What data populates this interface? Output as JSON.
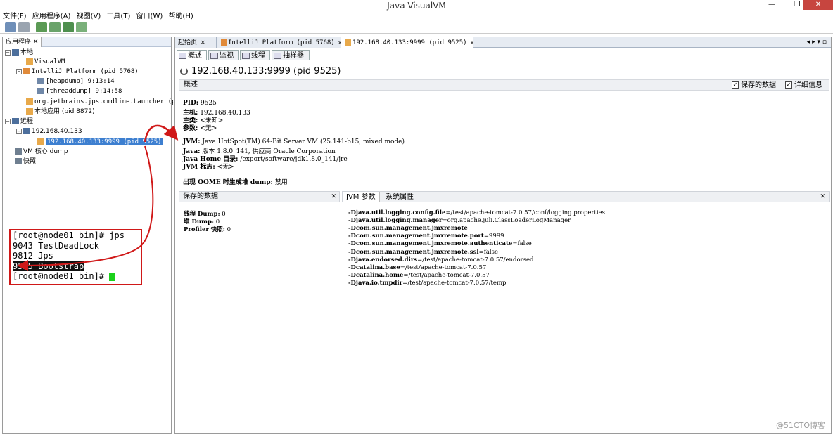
{
  "window": {
    "title": "Java VisualVM",
    "minimize": "—",
    "maximize": "❐",
    "close": "✕"
  },
  "menu": [
    "文件(F)",
    "应用程序(A)",
    "视图(V)",
    "工具(T)",
    "窗口(W)",
    "帮助(H)"
  ],
  "left_panel": {
    "tab_label": "应用程序",
    "tab_close": "✕",
    "minimize": "—",
    "tree": [
      {
        "label": "本地",
        "toggle": "−"
      },
      {
        "label": "VisualVM"
      },
      {
        "label": "IntelliJ Platform (pid 5768)",
        "toggle": "−"
      },
      {
        "label": "[heapdump] 9:13:14"
      },
      {
        "label": "[threaddump] 9:14:58"
      },
      {
        "label": "org.jetbrains.jps.cmdline.Launcher (pid"
      },
      {
        "label": "本地应用 (pid 8872)"
      },
      {
        "label": "远程",
        "toggle": "−"
      },
      {
        "label": "192.168.40.133",
        "toggle": "−"
      },
      {
        "label": "192.168.40.133:9999 (pid 9525)"
      },
      {
        "label": "VM 核心 dump"
      },
      {
        "label": "快照"
      }
    ]
  },
  "terminal": {
    "lines": [
      "[root@node01 bin]# jps",
      "9043 TestDeadLock",
      "9812 Jps"
    ],
    "highlight_pid": "9525",
    "highlight_name": "Bootstrap",
    "prompt": "[root@node01 bin]# "
  },
  "doc_tabs": [
    {
      "label": "起始页",
      "close": "✕"
    },
    {
      "label": "IntelliJ Platform (pid 5768)",
      "close": "✕"
    },
    {
      "label": "192.168.40.133:9999 (pid 9525)",
      "close": "✕"
    }
  ],
  "doc_tabs_nav": "◂ ▸ ▾ ▫",
  "sub_tabs": [
    "概述",
    "监视",
    "线程",
    "抽样器"
  ],
  "host_title": "192.168.40.133:9999 (pid 9525)",
  "overview": {
    "header": "概述",
    "checkbox_saved": "保存的数据",
    "checkbox_detail": "详细信息",
    "check": "✓",
    "pid_label": "PID:",
    "pid": "9525",
    "host_label": "主机:",
    "host": "192.168.40.133",
    "main_class_label": "主类:",
    "main_class": "<未知>",
    "args_label": "参数:",
    "args": "<无>",
    "jvm_label": "JVM:",
    "jvm": "Java HotSpot(TM) 64-Bit Server VM (25.141-b15, mixed mode)",
    "java_label": "Java:",
    "java": "版本 1.8.0_141, 供应商 Oracle Corporation",
    "java_home_label": "Java Home 目录:",
    "java_home": "/export/software/jdk1.8.0_141/jre",
    "jvm_flags_label": "JVM 标志:",
    "jvm_flags": "<无>",
    "oome_label": "出现 OOME 时生成堆 dump:",
    "oome": "禁用"
  },
  "saved_panel": {
    "title": "保存的数据",
    "close": "✕",
    "rows": [
      {
        "label": "线程 Dump:",
        "value": "0"
      },
      {
        "label": "堆 Dump:",
        "value": "0"
      },
      {
        "label": "Profiler 快照:",
        "value": "0"
      }
    ]
  },
  "jvm_panel": {
    "tabs": [
      "JVM 参数",
      "系统属性"
    ],
    "close": "✕",
    "args": [
      {
        "key": "-Djava.util.logging.config.file",
        "val": "=/test/apache-tomcat-7.0.57/conf/logging.properties"
      },
      {
        "key": "-Djava.util.logging.manager",
        "val": "=org.apache.juli.ClassLoaderLogManager"
      },
      {
        "key": "-Dcom.sun.management.jmxremote",
        "val": ""
      },
      {
        "key": "-Dcom.sun.management.jmxremote.port",
        "val": "=9999"
      },
      {
        "key": "-Dcom.sun.management.jmxremote.authenticate",
        "val": "=false"
      },
      {
        "key": "-Dcom.sun.management.jmxremote.ssl",
        "val": "=false"
      },
      {
        "key": "-Djava.endorsed.dirs",
        "val": "=/test/apache-tomcat-7.0.57/endorsed"
      },
      {
        "key": "-Dcatalina.base",
        "val": "=/test/apache-tomcat-7.0.57"
      },
      {
        "key": "-Dcatalina.home",
        "val": "=/test/apache-tomcat-7.0.57"
      },
      {
        "key": "-Djava.io.tmpdir",
        "val": "=/test/apache-tomcat-7.0.57/temp"
      }
    ]
  },
  "watermark": "@51CTO博客",
  "colors": {
    "selection": "#3d7fd0",
    "annotation": "#d01818",
    "cursor": "#1bd11b"
  }
}
